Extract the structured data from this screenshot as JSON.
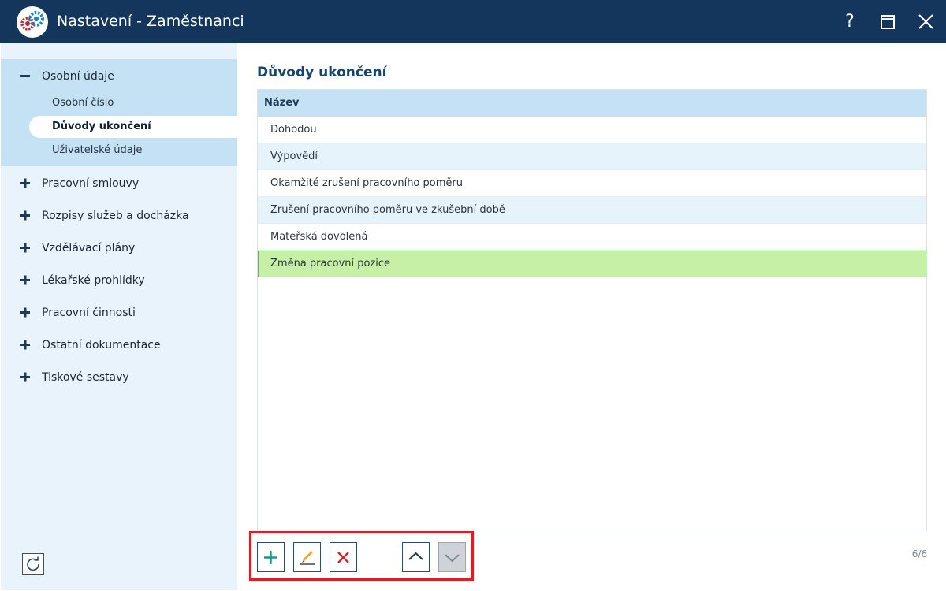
{
  "window": {
    "title": "Nastavení - Zaměstnanci",
    "help_label": "?",
    "title_bar_color": "#14365d",
    "icons": {
      "logo": "gears-logo-icon",
      "maximize": "maximize-icon",
      "close": "close-icon"
    }
  },
  "sidebar": {
    "groups": [
      {
        "label": "Osobní údaje",
        "expanded": true,
        "items": [
          {
            "label": "Osobní číslo",
            "active": false
          },
          {
            "label": "Důvody ukončení",
            "active": true
          },
          {
            "label": "Uživatelské údaje",
            "active": false
          }
        ]
      },
      {
        "label": "Pracovní smlouvy",
        "expanded": false
      },
      {
        "label": "Rozpisy služeb a docházka",
        "expanded": false
      },
      {
        "label": "Vzdělávací plány",
        "expanded": false
      },
      {
        "label": "Lékařské prohlídky",
        "expanded": false
      },
      {
        "label": "Pracovní činnosti",
        "expanded": false
      },
      {
        "label": "Ostatní dokumentace",
        "expanded": false
      },
      {
        "label": "Tiskové sestavy",
        "expanded": false
      }
    ],
    "refresh_icon": "refresh-icon"
  },
  "main": {
    "title": "Důvody ukončení",
    "table": {
      "column_header": "Název",
      "rows": [
        {
          "label": "Dohodou"
        },
        {
          "label": "Výpovědí"
        },
        {
          "label": "Okamžité zrušení pracovního poměru"
        },
        {
          "label": "Zrušení pracovního poměru ve zkušební době"
        },
        {
          "label": "Mateřská dovolená"
        },
        {
          "label": "Změna pracovní pozice",
          "selected": true
        }
      ]
    },
    "toolbar": {
      "add_icon": "plus-icon",
      "edit_icon": "pencil-icon",
      "delete_icon": "delete-x-icon",
      "move_up_icon": "chevron-up-icon",
      "move_down_icon": "chevron-down-icon",
      "move_down_enabled": false
    },
    "page_counter": "6/6"
  },
  "colors": {
    "accent": "#17446f",
    "selected_row": "#c6f0a5",
    "selected_row_border": "#5eb94c",
    "highlight_frame": "#e21c24"
  }
}
